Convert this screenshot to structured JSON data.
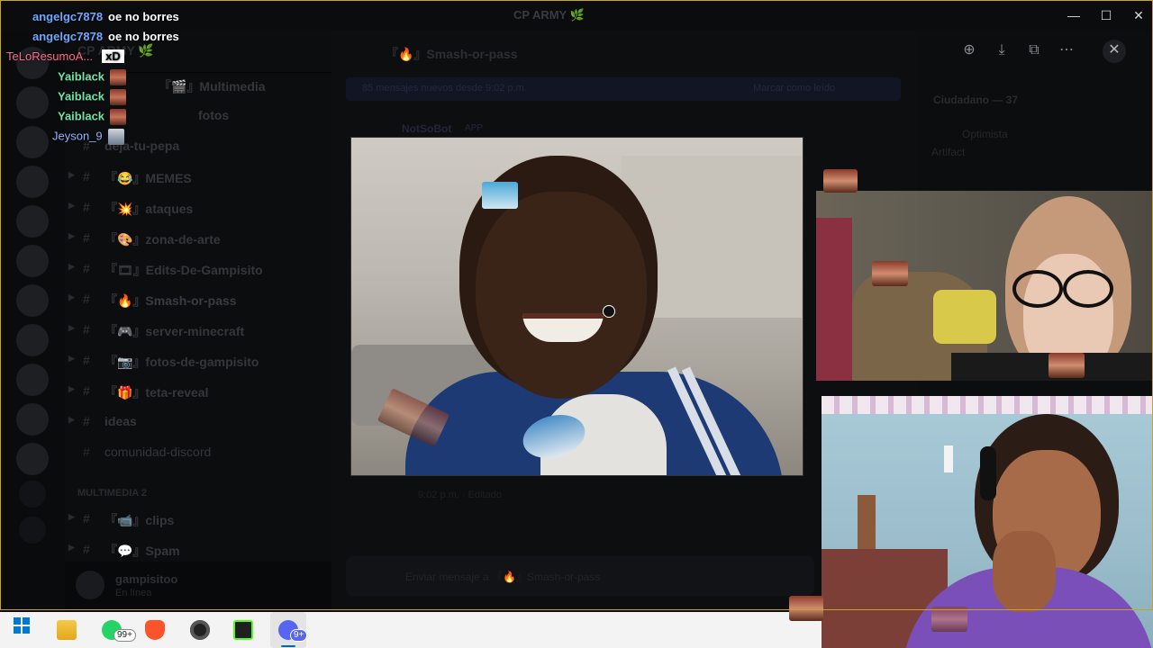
{
  "window": {
    "title": "CP ARMY 🌿",
    "minimize": "—",
    "maximize": "☐",
    "close": "✕"
  },
  "server": {
    "name": "CP ARMY 🌿",
    "channels": [
      {
        "name": "『🎬』Multimedia",
        "type": "category-like"
      },
      {
        "name": "fotos",
        "type": "text"
      },
      {
        "name": "deja-tu-pepa",
        "type": "text"
      },
      {
        "name": "『😂』MEMES",
        "type": "text"
      },
      {
        "name": "『💥』ataques",
        "type": "text"
      },
      {
        "name": "『🎨』zona-de-arte",
        "type": "text"
      },
      {
        "name": "『🎞』Edits-De-Gampisito",
        "type": "text"
      },
      {
        "name": "『🔥』Smash-or-pass",
        "type": "text"
      },
      {
        "name": "『🎮』server-minecraft",
        "type": "text"
      },
      {
        "name": "『📷』fotos-de-gampisito",
        "type": "text"
      },
      {
        "name": "『🎁』teta-reveal",
        "type": "text"
      },
      {
        "name": "ideas",
        "type": "text"
      },
      {
        "name": "comunidad-discord",
        "type": "text"
      },
      {
        "name": "『📹』clips",
        "type": "text"
      },
      {
        "name": "『💬』Spam",
        "type": "text"
      }
    ],
    "category_label": "MULTIMEDIA 2"
  },
  "user": {
    "name": "gampisitoo",
    "status": "En línea"
  },
  "chat": {
    "channel_title": "『🔥』Smash-or-pass",
    "new_messages_text": "85 mensajes nuevos desde 9:02 p.m.",
    "mark_read": "Marcar como leído",
    "author": "NotSoBot",
    "author_tag": "APP",
    "message_placeholder": "Enviar mensaje a 『🔥』Smash-or-pass",
    "footer_meta": "9:02 p.m.  ·  Editado"
  },
  "members": {
    "header": "Ciudadano — 37",
    "activity_name": "Optimista",
    "activity_sub": "Artifact"
  },
  "overlay_chat": [
    {
      "user": "angelgc7878",
      "color": "#6fa8ff",
      "message": "oe no borres"
    },
    {
      "user": "angelgc7878",
      "color": "#6fa8ff",
      "message": "oe no borres"
    },
    {
      "user": "TeLoResumoA...",
      "color": "#ff6b8b",
      "message": "xD"
    },
    {
      "user": "Yaiblack",
      "color": "#6fe3a8",
      "emote": "face"
    },
    {
      "user": "Yaiblack",
      "color": "#6fe3a8",
      "emote": "face"
    },
    {
      "user": "Yaiblack",
      "color": "#6fe3a8",
      "emote": "face"
    },
    {
      "user": "Jeyson_9",
      "color": "#8fb4ff",
      "emote": "face2"
    }
  ],
  "taskbar": {
    "whatsapp_badge": "99+",
    "discord_badge": "9+"
  },
  "colors": {
    "stream_frame": "#c9a227",
    "discord_blurple": "#5865f2",
    "taskbar_bg": "#f3f3f3"
  },
  "icons": {
    "zoom": "zoom-icon",
    "download": "download-icon",
    "open": "open-external-icon",
    "more": "more-icon",
    "close_viewer": "close-icon"
  }
}
